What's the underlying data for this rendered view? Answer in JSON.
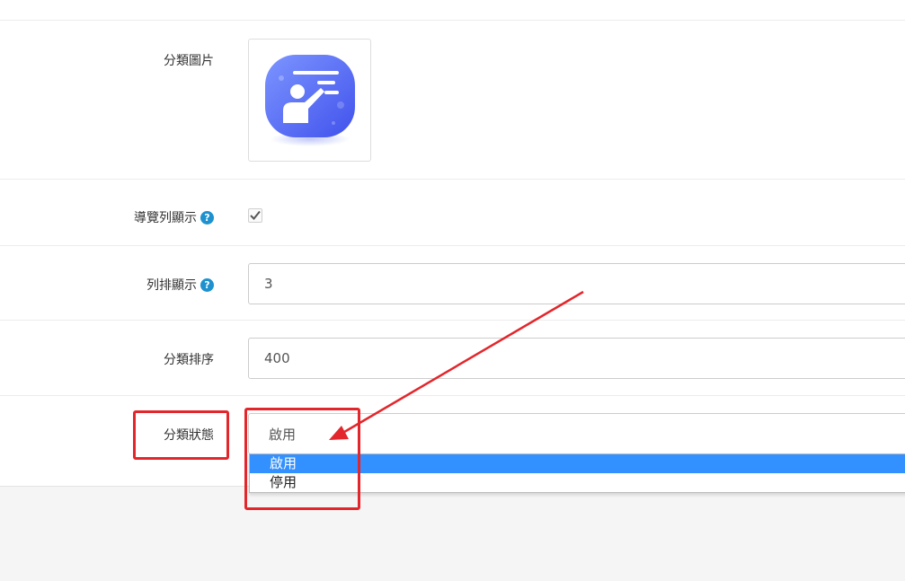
{
  "form": {
    "image_label": "分類圖片",
    "nav_label": "導覽列顯示",
    "nav_checked": true,
    "columns_label": "列排顯示",
    "columns_value": "3",
    "sort_label": "分類排序",
    "sort_value": "400",
    "status_label": "分類狀態",
    "status_value": "啟用",
    "status_options": [
      "啟用",
      "停用"
    ],
    "help_glyph": "?"
  },
  "colors": {
    "highlight": "#e3262b",
    "selected_option": "#3390ff",
    "help_badge": "#1e91cf",
    "icon_gradient_top": "#6f8dff",
    "icon_gradient_bottom": "#4a5cf0"
  },
  "icons": {
    "category_image": "presentation-teacher-icon",
    "help": "question-circle-icon",
    "check": "checkmark-icon"
  }
}
